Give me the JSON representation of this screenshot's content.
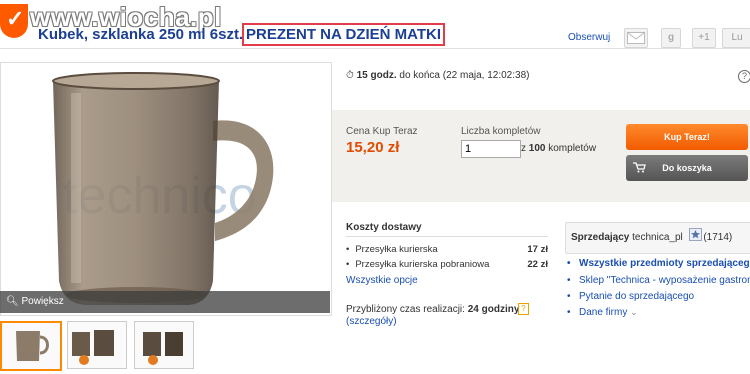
{
  "watermark": "www.wiocha.pl",
  "title": {
    "main": "Kubek, szklanka 250 ml 6szt.",
    "highlight": "PREZENT NA DZIEŃ MATKI"
  },
  "header": {
    "observe_label": "Obserwuj",
    "gplus_label": "+1",
    "like_label": "Lu"
  },
  "gallery": {
    "zoom_label": "Powiększ",
    "image_watermark": "technico"
  },
  "timer": {
    "hours": "15 godz.",
    "text": " do końca (22 maja, 12:02:38)",
    "help": "?"
  },
  "purchase": {
    "price_label": "Cena Kup Teraz",
    "price": "15,20 zł",
    "qty_label": "Liczba kompletów",
    "qty_value": "1",
    "qty_of_prefix": "z ",
    "qty_max": "100",
    "qty_of_suffix": " kompletów",
    "buy_now": "Kup Teraz!",
    "add_cart": "Do koszyka"
  },
  "shipping": {
    "title": "Koszty dostawy",
    "rows": [
      {
        "name": "Przesyłka kurierska",
        "price": "17 zł"
      },
      {
        "name": "Przesyłka kurierska pobraniowa",
        "price": "22 zł"
      }
    ],
    "all_options": "Wszystkie opcje",
    "time_label": "Przybliżony czas realizacji: ",
    "time_value": "24 godziny",
    "details": "(szczegóły)"
  },
  "seller": {
    "label": "Sprzedający",
    "name": "technica_pl",
    "rating": "(1714)",
    "links": [
      "Wszystkie przedmioty sprzedającego",
      "Sklep \"Technica - wyposażenie gastronomii\"",
      "Pytanie do sprzedającego",
      "Dane firmy"
    ]
  },
  "colors": {
    "brand_orange": "#ff5a00",
    "price_orange": "#e14b00",
    "title_blue": "#1c3f95",
    "highlight_border": "#e23b4a"
  }
}
